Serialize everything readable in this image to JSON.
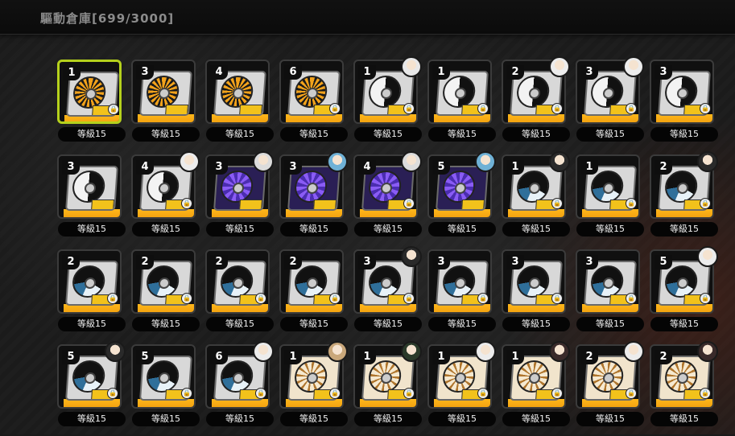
{
  "header": {
    "title": "驅動倉庫[699/3000]"
  },
  "colors": {
    "selected_border": "#b5d11c",
    "card_bar": "#ffb71a",
    "background": "#1a1a1a"
  },
  "drives": [
    {
      "rarity": "1",
      "level": "等級15",
      "theme": "tiger",
      "character": "",
      "locked": true,
      "selected": true
    },
    {
      "rarity": "3",
      "level": "等級15",
      "theme": "tiger",
      "character": "",
      "locked": false
    },
    {
      "rarity": "4",
      "level": "等級15",
      "theme": "tiger",
      "character": "",
      "locked": false
    },
    {
      "rarity": "6",
      "level": "等級15",
      "theme": "tiger",
      "character": "",
      "locked": true
    },
    {
      "rarity": "1",
      "level": "等級15",
      "theme": "yinyang",
      "character": "#e8e8e8",
      "locked": true
    },
    {
      "rarity": "1",
      "level": "等級15",
      "theme": "yinyang",
      "character": "",
      "locked": true
    },
    {
      "rarity": "2",
      "level": "等級15",
      "theme": "yinyang",
      "character": "#ececec",
      "locked": true
    },
    {
      "rarity": "3",
      "level": "等級15",
      "theme": "yinyang",
      "character": "#ececec",
      "locked": true
    },
    {
      "rarity": "3",
      "level": "等級15",
      "theme": "yinyang",
      "character": "",
      "locked": true
    },
    {
      "rarity": "3",
      "level": "等級15",
      "theme": "yinyang",
      "character": "",
      "locked": false
    },
    {
      "rarity": "4",
      "level": "等級15",
      "theme": "yinyang",
      "character": "#ececec",
      "locked": true
    },
    {
      "rarity": "3",
      "level": "等級15",
      "theme": "purple",
      "character": "#dcdcdc",
      "locked": false
    },
    {
      "rarity": "3",
      "level": "等級15",
      "theme": "purple",
      "character": "#6fb1d6",
      "locked": false
    },
    {
      "rarity": "4",
      "level": "等級15",
      "theme": "purple",
      "character": "#dcdcdc",
      "locked": true
    },
    {
      "rarity": "5",
      "level": "等級15",
      "theme": "purple",
      "character": "#6fb1d6",
      "locked": false
    },
    {
      "rarity": "1",
      "level": "等級15",
      "theme": "wave",
      "character": "#2a2a2a",
      "locked": true
    },
    {
      "rarity": "1",
      "level": "等級15",
      "theme": "wave",
      "character": "",
      "locked": true
    },
    {
      "rarity": "2",
      "level": "等級15",
      "theme": "wave",
      "character": "#2a2a2a",
      "locked": true
    },
    {
      "rarity": "2",
      "level": "等級15",
      "theme": "wave",
      "character": "",
      "locked": true
    },
    {
      "rarity": "2",
      "level": "等級15",
      "theme": "wave",
      "character": "",
      "locked": true
    },
    {
      "rarity": "2",
      "level": "等級15",
      "theme": "wave",
      "character": "",
      "locked": true
    },
    {
      "rarity": "2",
      "level": "等級15",
      "theme": "wave",
      "character": "",
      "locked": true
    },
    {
      "rarity": "3",
      "level": "等級15",
      "theme": "wave",
      "character": "#2a2a2a",
      "locked": true
    },
    {
      "rarity": "3",
      "level": "等級15",
      "theme": "wave",
      "character": "",
      "locked": true
    },
    {
      "rarity": "3",
      "level": "等級15",
      "theme": "wave",
      "character": "",
      "locked": true
    },
    {
      "rarity": "3",
      "level": "等級15",
      "theme": "wave",
      "character": "",
      "locked": true
    },
    {
      "rarity": "5",
      "level": "等級15",
      "theme": "wave",
      "character": "#ececec",
      "locked": true
    },
    {
      "rarity": "5",
      "level": "等級15",
      "theme": "wave",
      "character": "#2a2a2a",
      "locked": true
    },
    {
      "rarity": "5",
      "level": "等級15",
      "theme": "wave",
      "character": "",
      "locked": true
    },
    {
      "rarity": "6",
      "level": "等級15",
      "theme": "wave",
      "character": "#ececec",
      "locked": true
    },
    {
      "rarity": "1",
      "level": "等級15",
      "theme": "flower",
      "character": "#c9a77a",
      "locked": true
    },
    {
      "rarity": "1",
      "level": "等級15",
      "theme": "flower",
      "character": "#2a3a2a",
      "locked": true
    },
    {
      "rarity": "1",
      "level": "等級15",
      "theme": "flower",
      "character": "#ececec",
      "locked": true
    },
    {
      "rarity": "1",
      "level": "等級15",
      "theme": "flower",
      "character": "#3a2a2a",
      "locked": true
    },
    {
      "rarity": "2",
      "level": "等級15",
      "theme": "flower",
      "character": "#ececec",
      "locked": true
    },
    {
      "rarity": "2",
      "level": "等級15",
      "theme": "flower",
      "character": "#3a2a2a",
      "locked": true
    }
  ]
}
